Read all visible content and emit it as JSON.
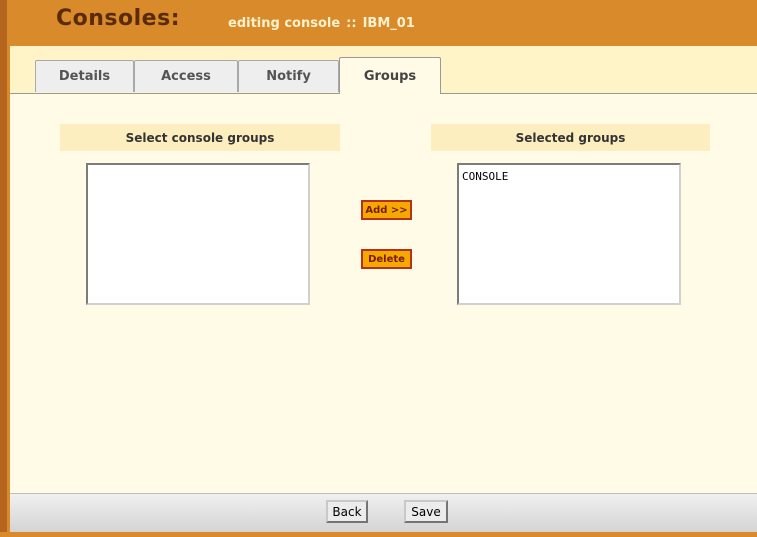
{
  "header": {
    "title": "Consoles:",
    "subtitle_prefix": "editing console",
    "subtitle_sep": "::",
    "console_name": "IBM_01"
  },
  "tabs": [
    {
      "label": "Details"
    },
    {
      "label": "Access"
    },
    {
      "label": "Notify"
    },
    {
      "label": "Groups"
    }
  ],
  "active_tab": "Groups",
  "left_panel": {
    "title": "Select console groups",
    "items": []
  },
  "right_panel": {
    "title": "Selected groups",
    "items": [
      "CONSOLE"
    ]
  },
  "actions": {
    "add_label": "Add >>",
    "delete_label": "Delete"
  },
  "footer": {
    "back_label": "Back",
    "save_label": "Save"
  },
  "colors": {
    "header_bg": "#d98a2a",
    "content_bg": "#fffbe6",
    "panel_header_bg": "#fdeec0",
    "action_button_bg": "#f5a800"
  }
}
